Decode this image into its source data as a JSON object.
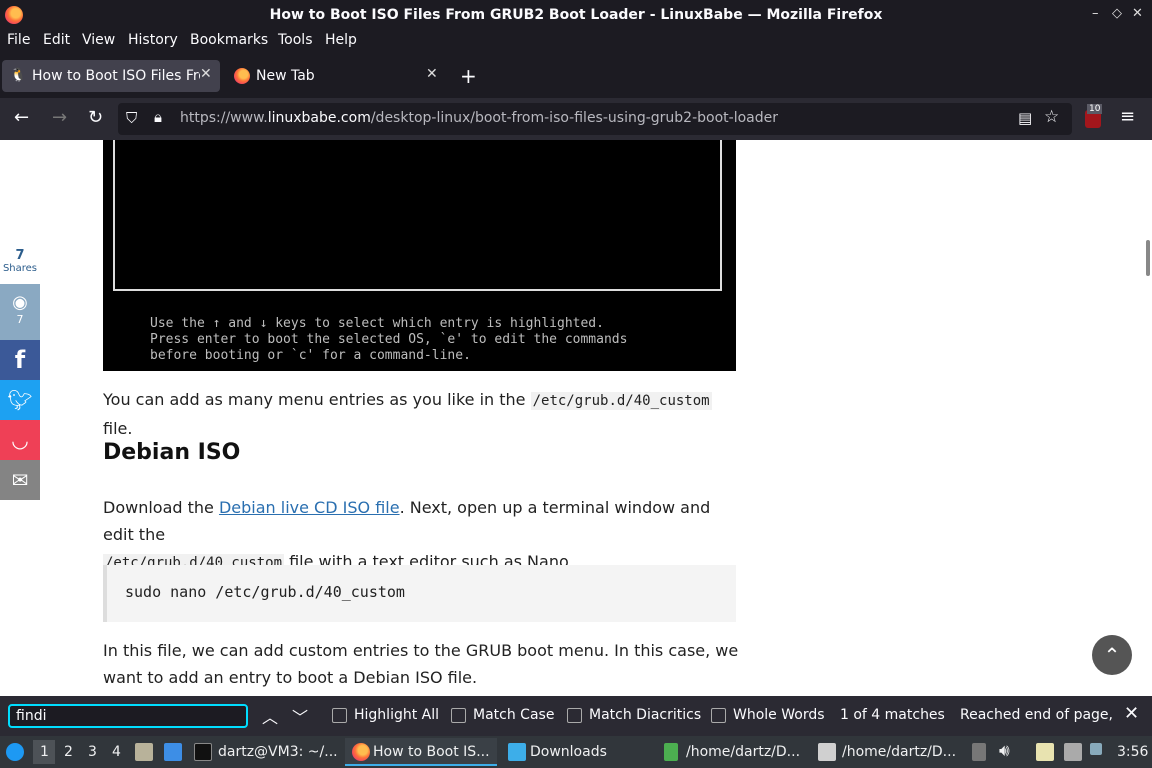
{
  "window": {
    "title": "How to Boot ISO Files From GRUB2 Boot Loader - LinuxBabe — Mozilla Firefox"
  },
  "menu": [
    "File",
    "Edit",
    "View",
    "History",
    "Bookmarks",
    "Tools",
    "Help"
  ],
  "tabs": [
    {
      "label": "How to Boot ISO Files Fro",
      "active": true
    },
    {
      "label": "New Tab",
      "active": false
    }
  ],
  "nav": {
    "url_prefix": "https://www.",
    "url_domain": "linuxbabe.com",
    "url_path": "/desktop-linux/boot-from-iso-files-using-grub2-boot-loader",
    "extension_badge": "10"
  },
  "share": {
    "count": "7",
    "label": "Shares",
    "reddit_count": "7"
  },
  "content": {
    "grub_help": "Use the ↑ and ↓ keys to select which entry is highlighted.\nPress enter to boot the selected OS, `e' to edit the commands\nbefore booting or `c' for a command-line.",
    "para1_pre": "You can add as many menu entries as you like in the ",
    "para1_code": "/etc/grub.d/40_custom",
    "para1_post": " file.",
    "heading": "Debian ISO",
    "para2_pre": "Download the ",
    "para2_link": "Debian live CD ISO file",
    "para2_mid": ". Next, open up a terminal window and edit the",
    "para2_code": "/etc/grub.d/40_custom",
    "para2_post": " file with a text editor such as Nano.",
    "codeblock": "sudo nano /etc/grub.d/40_custom",
    "para3": "In this file, we can add custom entries to the GRUB boot menu. In this case, we want to add an entry to boot a Debian ISO file."
  },
  "findbar": {
    "query": "findi",
    "highlight_all": "Highlight All",
    "match_case": "Match Case",
    "match_diacritics": "Match Diacritics",
    "whole_words": "Whole Words",
    "matches": "1 of 4 matches",
    "status": "Reached end of page, c"
  },
  "taskbar": {
    "desktops": [
      "1",
      "2",
      "3",
      "4"
    ],
    "items": [
      "dartz@VM3: ~/...",
      "How to Boot IS...",
      "Downloads",
      "/home/dartz/D...",
      "/home/dartz/D..."
    ],
    "clock": "3:56"
  }
}
